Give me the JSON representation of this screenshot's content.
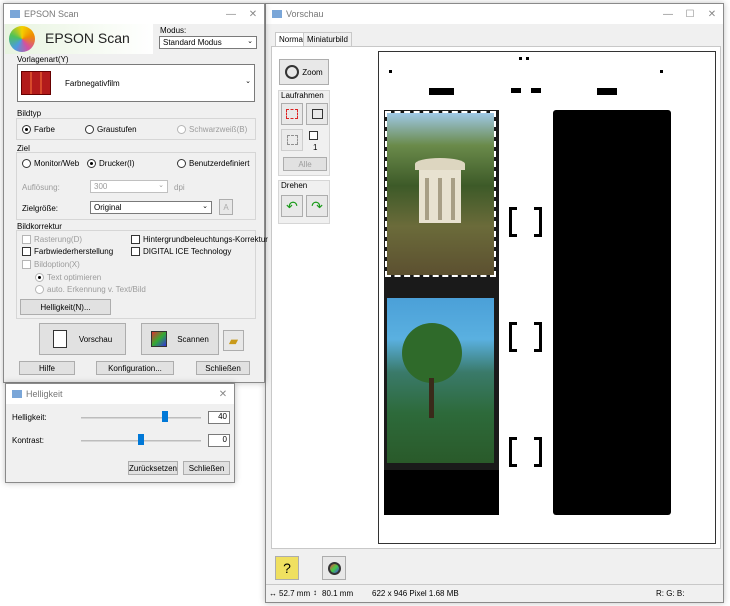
{
  "epson": {
    "title": "EPSON Scan",
    "logo_text": "EPSON Scan",
    "mode_label": "Modus:",
    "mode_value": "Standard Modus",
    "doctype_label": "Vorlagenart(Y)",
    "doctype_value": "Farbnegativfilm",
    "bildtyp_label": "Bildtyp",
    "farbe": "Farbe",
    "graustufen": "Graustufen",
    "schwarzweiss": "Schwarzweiß(B)",
    "ziel_label": "Ziel",
    "monitor": "Monitor/Web",
    "drucker": "Drucker(I)",
    "benutzer": "Benutzerdefiniert",
    "aufloesung_label": "Auflösung:",
    "aufloesung_value": "300",
    "dpi": "dpi",
    "zielgroesse_label": "Zielgröße:",
    "zielgroesse_value": "Original",
    "bildkorrektur_label": "Bildkorrektur",
    "rasterung": "Rasterung(D)",
    "hintergrund": "Hintergrundbeleuchtungs-Korrektur",
    "farbwieder": "Farbwiederherstellung",
    "digital_ice": "DIGITAL ICE Technology",
    "bildoption": "Bildoption(X)",
    "text_opt": "Text optimieren",
    "auto_erk": "auto. Erkennung v. Text/Bild",
    "helligkeit_btn": "Helligkeit(N)...",
    "vorschau_btn": "Vorschau",
    "scannen_btn": "Scannen",
    "hilfe_btn": "Hilfe",
    "konfig_btn": "Konfiguration...",
    "schliessen_btn": "Schließen"
  },
  "helligkeit": {
    "title": "Helligkeit",
    "helligkeit_label": "Helligkeit:",
    "helligkeit_value": "40",
    "helligkeit_level": 0.7,
    "kontrast_label": "Kontrast:",
    "kontrast_value": "0",
    "kontrast_level": 0.5,
    "reset_btn": "Zurücksetzen",
    "close_btn": "Schließen"
  },
  "vorschau": {
    "title": "Vorschau",
    "tab_normal": "Normal",
    "tab_mini": "Miniaturbild",
    "zoom_btn": "Zoom",
    "laufrahmen_label": "Laufrahmen",
    "frame_count": "1",
    "alle_btn": "Alle",
    "drehen_label": "Drehen",
    "status_size": "52.7 mm",
    "status_size2": "80.1 mm",
    "status_pixels": "622 x 946 Pixel 1.68 MB",
    "status_rgb": "R: G: B:"
  }
}
